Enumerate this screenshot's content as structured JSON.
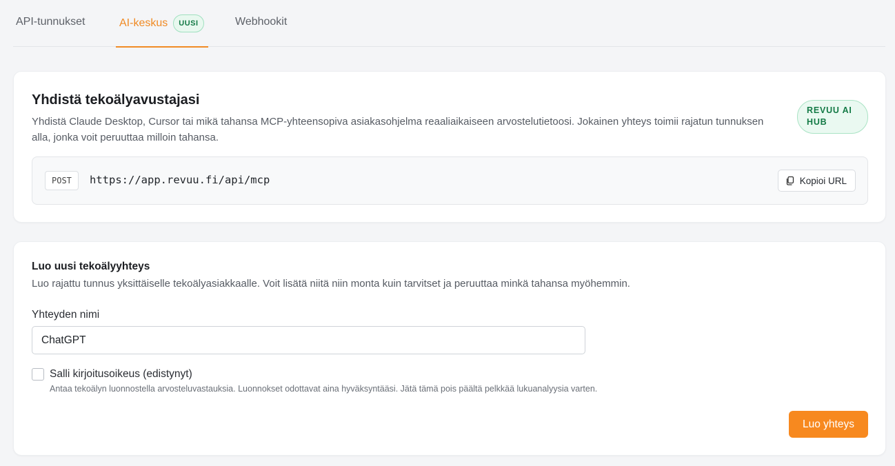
{
  "tabs": [
    {
      "label": "API-tunnukset"
    },
    {
      "label": "AI-keskus",
      "badge": "UUSI",
      "active": true
    },
    {
      "label": "Webhookit"
    }
  ],
  "connect_card": {
    "title": "Yhdistä tekoälyavustajasi",
    "description": "Yhdistä Claude Desktop, Cursor tai mikä tahansa MCP-yhteensopiva asiakasohjelma reaaliaikaiseen arvostelutietoosi. Jokainen yhteys toimii rajatun tunnuksen alla, jonka voit peruuttaa milloin tahansa.",
    "hub_badge": "REVUU AI HUB",
    "endpoint": {
      "method": "POST",
      "url": "https://app.revuu.fi/api/mcp",
      "copy_label": "Kopioi URL",
      "copy_icon": "copy-icon"
    }
  },
  "create_card": {
    "title": "Luo uusi tekoälyyhteys",
    "description": "Luo rajattu tunnus yksittäiselle tekoälyasiakkaalle. Voit lisätä niitä niin monta kuin tarvitset ja peruuttaa minkä tahansa myöhemmin.",
    "name_label": "Yhteyden nimi",
    "name_value": "ChatGPT",
    "write_access_label": "Salli kirjoitusoikeus (edistynyt)",
    "write_access_checked": false,
    "write_access_help": "Antaa tekoälyn luonnostella arvosteluvastauksia. Luonnokset odottavat aina hyväksyntääsi. Jätä tämä pois päältä pelkkää lukuanalyysia varten.",
    "submit_label": "Luo yhteys"
  },
  "colors": {
    "accent": "#f7891f",
    "badge_green": "#147a46",
    "background": "#f4f5f7"
  }
}
